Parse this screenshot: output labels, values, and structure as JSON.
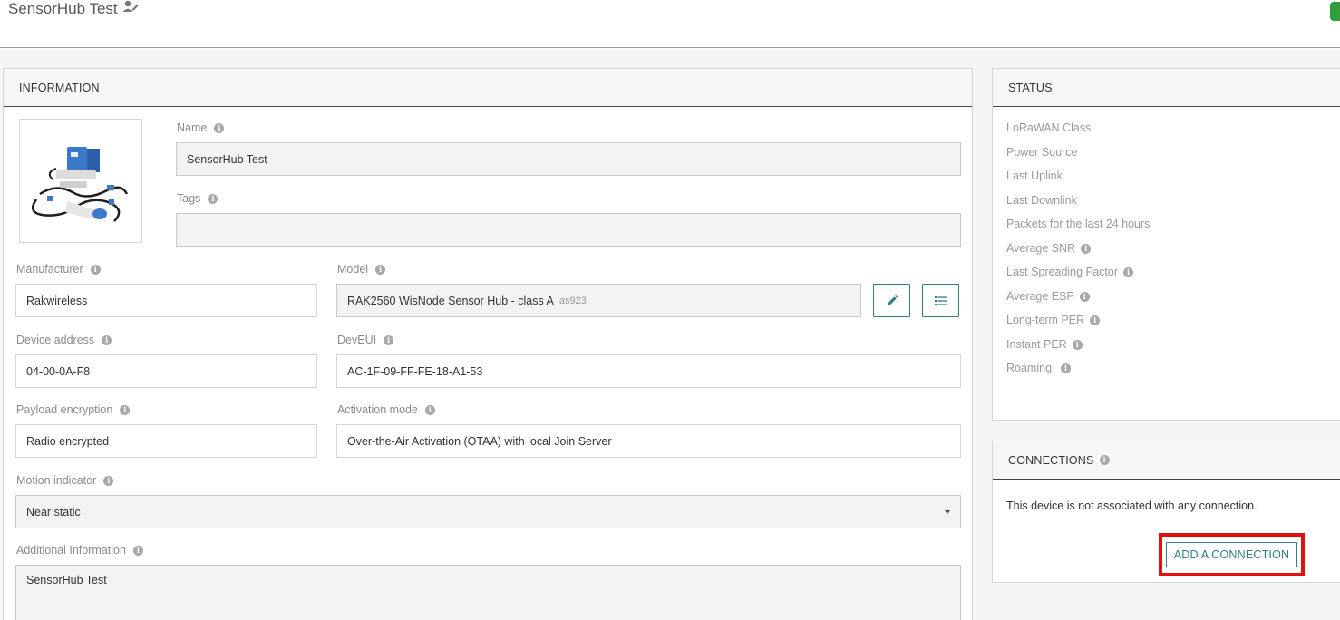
{
  "header": {
    "title": "SensorHub Test",
    "edit_icon": "user-edit-icon"
  },
  "information": {
    "heading": "INFORMATION",
    "name": {
      "label": "Name",
      "value": "SensorHub Test"
    },
    "tags": {
      "label": "Tags",
      "value": ""
    },
    "manufacturer": {
      "label": "Manufacturer",
      "value": "Rakwireless"
    },
    "model": {
      "label": "Model",
      "value": "RAK2560 WisNode Sensor Hub - class A",
      "region": "as923",
      "edit_icon": "pencil-icon",
      "list_icon": "list-icon"
    },
    "device_address": {
      "label": "Device address",
      "value": "04-00-0A-F8"
    },
    "deveui": {
      "label": "DevEUI",
      "value": "AC-1F-09-FF-FE-18-A1-53"
    },
    "payload_encryption": {
      "label": "Payload encryption",
      "value": "Radio encrypted"
    },
    "activation_mode": {
      "label": "Activation mode",
      "value": "Over-the-Air Activation (OTAA) with local Join Server"
    },
    "motion_indicator": {
      "label": "Motion indicator",
      "value": "Near static"
    },
    "additional_information": {
      "label": "Additional Information",
      "value": "SensorHub Test"
    }
  },
  "status": {
    "heading": "STATUS",
    "items": [
      {
        "label": "LoRaWAN Class",
        "info": false
      },
      {
        "label": "Power Source",
        "info": false
      },
      {
        "label": "Last Uplink",
        "info": false
      },
      {
        "label": "Last Downlink",
        "info": false
      },
      {
        "label": "Packets for the last 24 hours",
        "info": false
      },
      {
        "label": "Average SNR",
        "info": true
      },
      {
        "label": "Last Spreading Factor",
        "info": true
      },
      {
        "label": "Average ESP",
        "info": true
      },
      {
        "label": "Long-term PER",
        "info": true
      },
      {
        "label": "Instant PER",
        "info": true
      },
      {
        "label": "Roaming",
        "info": true
      }
    ]
  },
  "connections": {
    "heading": "CONNECTIONS",
    "message": "This device is not associated with any connection.",
    "add_button": "ADD A CONNECTION"
  },
  "colors": {
    "accent": "#2f7f85",
    "highlight": "#e01010",
    "status_green": "#2e9e3e"
  }
}
